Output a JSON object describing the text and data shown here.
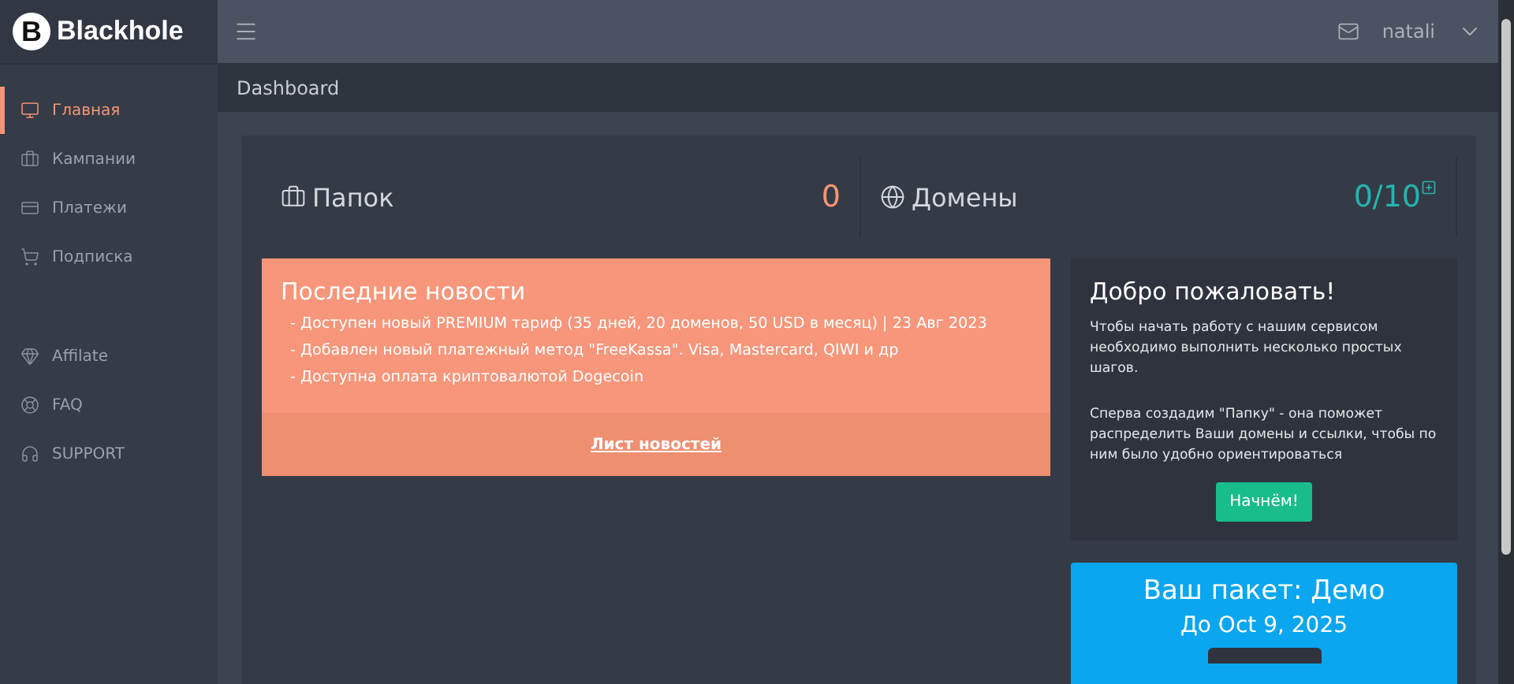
{
  "logo": {
    "mark": "B",
    "text": "Blackhole"
  },
  "user": {
    "name": "natali"
  },
  "sidebar": {
    "items": [
      {
        "label": "Главная",
        "selected": true
      },
      {
        "label": "Кампании",
        "selected": false
      },
      {
        "label": "Платежи",
        "selected": false
      },
      {
        "label": "Подписка",
        "selected": false
      }
    ],
    "extra_items": [
      {
        "label": "Affilate",
        "selected": false
      },
      {
        "label": "FAQ",
        "selected": false
      },
      {
        "label": "SUPPORT",
        "selected": false
      }
    ]
  },
  "breadcrumb": "Dashboard",
  "stats": [
    {
      "label": "Папок",
      "value": "0",
      "kind": "count"
    },
    {
      "label": "Домены",
      "value": "0/10",
      "kind": "quota"
    }
  ],
  "news": {
    "title": "Последние новости",
    "items": [
      "- Доступен новый PREMIUM тариф (35 дней, 20 доменов, 50 USD в месяц) | 23 Авг 2023",
      "- Добавлен новый платежный метод \"FreeKassa\". Visa, Mastercard, QIWI и др",
      "- Доступна оплата криптовалютой Dogecoin"
    ],
    "link": "Лист новостей"
  },
  "welcome": {
    "title": "Добро пожаловать!",
    "paragraphs": [
      "Чтобы начать работу с нашим сервисом необходимо выполнить несколько простых шагов.",
      "Сперва создадим \"Папку\" - она поможет распределить Ваши домены и ссылки, чтобы по ним было удобно ориентироваться"
    ],
    "button": "Начнём!"
  },
  "package": {
    "title": "Ваш пакет: Демо",
    "until": "До Oct 9, 2025"
  }
}
